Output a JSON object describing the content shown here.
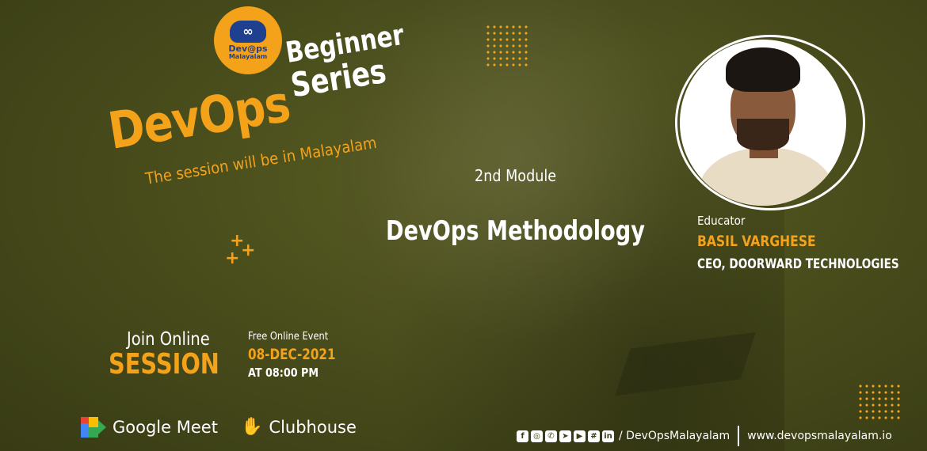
{
  "logo": {
    "line1": "Dev@ps",
    "line2": "Malayalam",
    "glyph": "∞"
  },
  "title": {
    "main": "DevOps",
    "beginner": "Beginner",
    "series": "Series",
    "note": "The session will be in Malayalam"
  },
  "module": {
    "label": "2nd Module",
    "topic": "DevOps Methodology"
  },
  "educator": {
    "label": "Educator",
    "name": "BASIL VARGHESE",
    "role": "CEO, DOORWARD TECHNOLOGIES"
  },
  "join": {
    "line1": "Join Online",
    "line2": "SESSION"
  },
  "event": {
    "free": "Free Online Event",
    "date": "08-DEC-2021",
    "time": "AT 08:00 PM"
  },
  "platforms": [
    {
      "name": "Google Meet",
      "icon": "google-meet-icon"
    },
    {
      "name": "Clubhouse",
      "icon": "waving-hand-icon"
    }
  ],
  "footer": {
    "social_icons": [
      "facebook-icon",
      "instagram-icon",
      "whatsapp-icon",
      "telegram-icon",
      "youtube-icon",
      "slack-icon",
      "linkedin-icon"
    ],
    "handle": "/ DevOpsMalayalam",
    "website": "www.devopsmalayalam.io"
  },
  "colors": {
    "accent": "#f5a21b",
    "background": "#4a4e1c",
    "brand_blue": "#1f3f8f"
  }
}
